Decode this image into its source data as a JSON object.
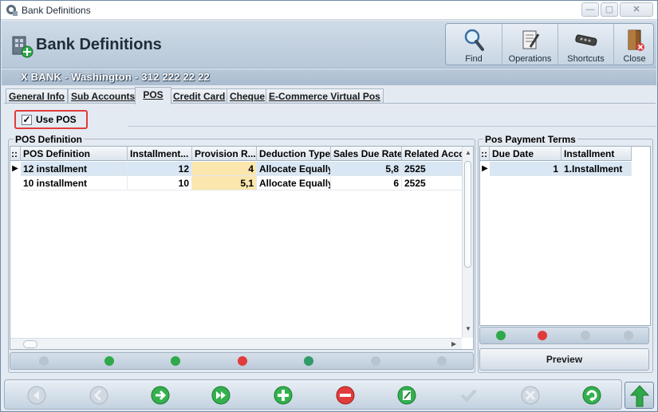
{
  "window": {
    "title": "Bank Definitions",
    "controls": {
      "minimize": "—",
      "maximize": "▢",
      "close": "✕"
    }
  },
  "header": {
    "title": "Bank Definitions",
    "tools": [
      {
        "label": "Find",
        "icon": "magnifier-icon"
      },
      {
        "label": "Operations",
        "icon": "operations-icon"
      },
      {
        "label": "Shortcuts",
        "icon": "shortcuts-icon"
      },
      {
        "label": "Close",
        "icon": "door-close-icon"
      }
    ]
  },
  "info": {
    "text": "X BANK  -  Washington  -  312 222 22 22"
  },
  "tabs": [
    {
      "label": "General Info",
      "active": false
    },
    {
      "label": "Sub Accounts",
      "active": false
    },
    {
      "label": "POS",
      "active": true
    },
    {
      "label": "Credit Card",
      "active": false
    },
    {
      "label": "Cheque",
      "active": false
    },
    {
      "label": "E-Commerce Virtual Pos",
      "active": false
    }
  ],
  "use_pos": {
    "label": "Use POS",
    "checked": true,
    "mark": "✓"
  },
  "pos_definition": {
    "group_title": "POS Definition",
    "corner": "::",
    "columns": [
      "POS Definition",
      "Installment...",
      "Provision R...",
      "Deduction Type",
      "Sales Due Rate",
      "Related Acco"
    ],
    "rows": [
      {
        "name": "12 installment",
        "installment": "12",
        "provision": "4",
        "deduction": "Allocate Equally",
        "sales_due_rate": "5,8",
        "related": "2525",
        "selected": true
      },
      {
        "name": "10 installment",
        "installment": "10",
        "provision": "5,1",
        "deduction": "Allocate Equally",
        "sales_due_rate": "6",
        "related": "2525",
        "selected": false
      }
    ]
  },
  "payment_terms": {
    "group_title": "Pos Payment Terms",
    "corner": "::",
    "columns": [
      "Due Date",
      "Installment"
    ],
    "rows": [
      {
        "due_date": "1",
        "installment": "1.Installment"
      }
    ],
    "preview_label": "Preview"
  },
  "colors": {
    "accent_red": "#e03c3c",
    "highlight_yellow": "#fbe7ae",
    "selection": "#d9e6f3",
    "green": "#2fa84a"
  }
}
